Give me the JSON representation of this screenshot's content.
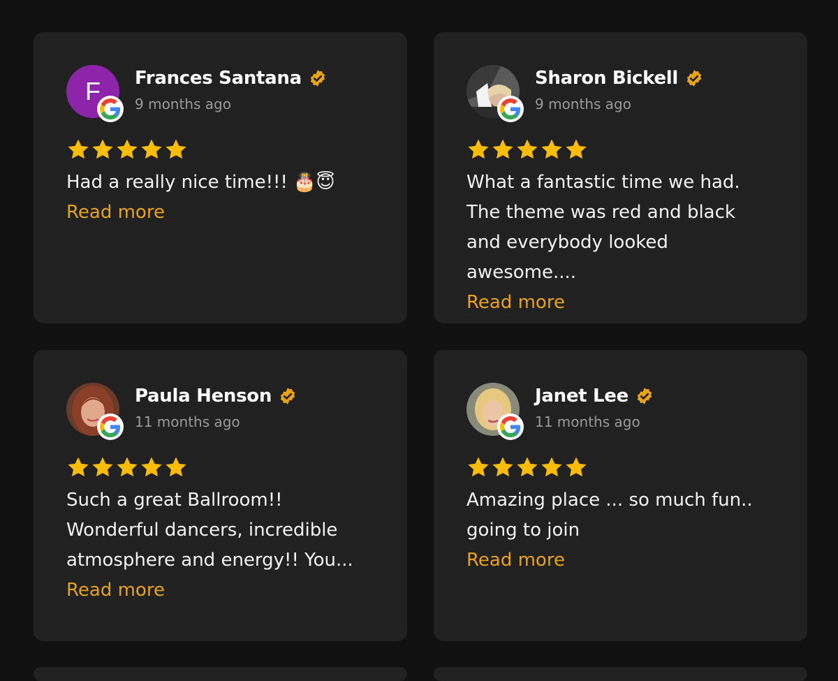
{
  "colors": {
    "background": "#111111",
    "card": "#212121",
    "star": "#fbbc04",
    "accent": "#e8a317",
    "verified": "#e8a317"
  },
  "reviews": [
    {
      "name": "Frances Santana",
      "avatar_letter": "F",
      "time": "9 months ago",
      "rating": 5,
      "text": "Had a really nice time!!! 🎂😇",
      "read_more": "Read more"
    },
    {
      "name": "Sharon Bickell",
      "avatar_letter": "",
      "time": "9 months ago",
      "rating": 5,
      "text": "What a fantastic time we had. The theme was red and black and everybody looked awesome....",
      "read_more": "Read more"
    },
    {
      "name": "Paula Henson",
      "avatar_letter": "",
      "time": "11 months ago",
      "rating": 5,
      "text": "Such a great Ballroom!! Wonderful dancers, incredible atmosphere and energy!! You...",
      "read_more": "Read more"
    },
    {
      "name": "Janet Lee",
      "avatar_letter": "",
      "time": "11 months ago",
      "rating": 5,
      "text": "Amazing place ... so much fun.. going to join",
      "read_more": "Read more"
    }
  ],
  "icons": {
    "source": "google-icon",
    "verified": "verified-badge-icon",
    "star": "star-icon"
  }
}
